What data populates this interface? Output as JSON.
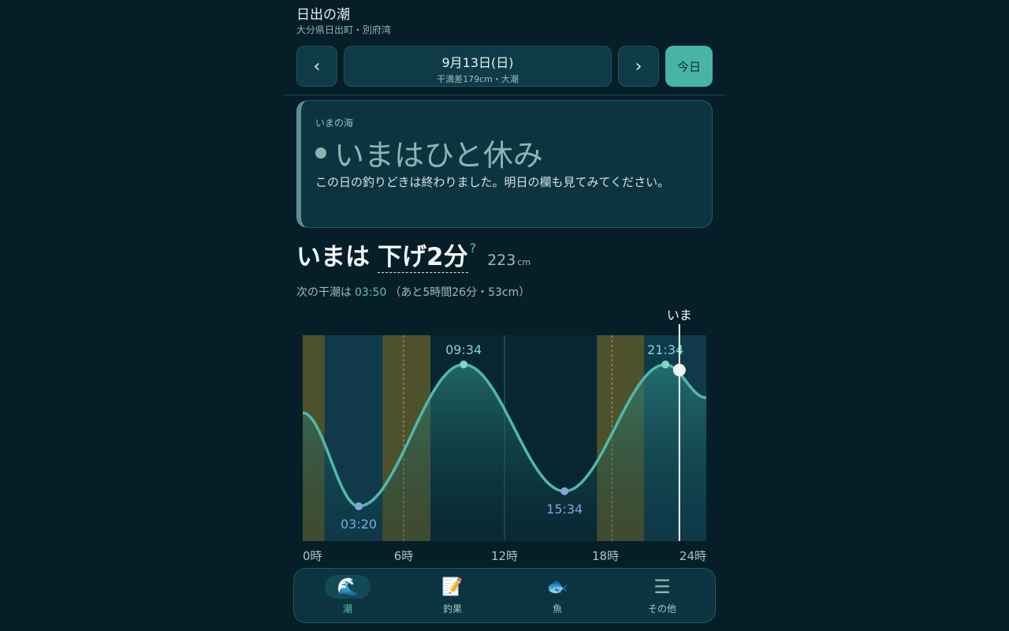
{
  "header": {
    "title": "日出の潮",
    "location": "大分県日出町・別府湾"
  },
  "date_nav": {
    "prev_label": "‹",
    "next_label": "›",
    "date": "9月13日(日)",
    "subtitle": "干満差179cm・大潮",
    "today_label": "今日"
  },
  "sea_card": {
    "label": "いまの海",
    "state": "いまはひと休み",
    "description": "この日の釣りどきは終わりました。明日の欄も見てみてください。",
    "accent_color": "#5e8e93"
  },
  "now": {
    "prefix": "いまは",
    "phase": "下げ2分",
    "help": "?",
    "height": "223",
    "unit": "cm"
  },
  "next_tide": {
    "prefix": "次の干潮は",
    "time": "03:50",
    "detail": "（あと5時間26分・53cm）"
  },
  "chart_data": {
    "type": "line",
    "x_unit": "hours",
    "xlim": [
      0,
      24
    ],
    "x_ticks": [
      {
        "hour": 0,
        "label": "0時"
      },
      {
        "hour": 6,
        "label": "6時"
      },
      {
        "hour": 12,
        "label": "12時"
      },
      {
        "hour": 18,
        "label": "18時"
      },
      {
        "hour": 24,
        "label": "24時"
      }
    ],
    "ylim": [
      0,
      260
    ],
    "extremes": [
      {
        "time": "03:20",
        "hour": 3.33,
        "height": 44,
        "kind": "low"
      },
      {
        "time": "09:34",
        "hour": 9.57,
        "height": 223,
        "kind": "high"
      },
      {
        "time": "15:34",
        "hour": 15.57,
        "height": 63,
        "kind": "low"
      },
      {
        "time": "21:34",
        "hour": 21.57,
        "height": 223,
        "kind": "high"
      }
    ],
    "start_height": 162,
    "end_height": 181,
    "now_hour": 22.4,
    "now_height": 216,
    "now_label": "いま",
    "twilight_bands": [
      [
        0,
        1.3
      ],
      [
        4.75,
        7.6
      ],
      [
        17.5,
        20.3
      ]
    ],
    "night_bands": [
      [
        1.3,
        4.75
      ],
      [
        20.3,
        24
      ]
    ],
    "sun_lines": [
      6,
      18.4
    ],
    "colors": {
      "line": "#4fb9a9",
      "high_point": "#7fd7c8",
      "low_point": "#7fa7df",
      "twilight": "#5a5a2c",
      "night": "#103a4a"
    }
  },
  "bottom_nav": [
    {
      "icon": "🌊",
      "label": "潮",
      "active": true
    },
    {
      "icon": "📝",
      "label": "釣果",
      "active": false
    },
    {
      "icon": "🐟",
      "label": "魚",
      "active": false
    },
    {
      "icon": "☰",
      "label": "その他",
      "active": false
    }
  ]
}
